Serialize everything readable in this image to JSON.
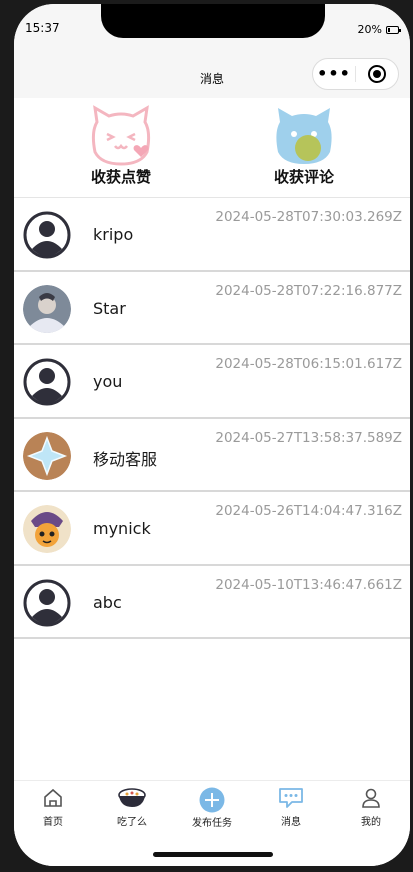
{
  "status_bar": {
    "time": "15:37",
    "battery_percent_text": "20%",
    "battery_level": 0.2
  },
  "nav": {
    "title": "消息"
  },
  "stats": [
    {
      "label": "收获点赞",
      "icon": "cat-heart-icon",
      "color": "#f4b6c0"
    },
    {
      "label": "收获评论",
      "icon": "cat-comment-icon",
      "color": "#9fd0ec"
    }
  ],
  "messages": [
    {
      "name": "kripo",
      "time": "2024-05-28T07:30:03.269Z",
      "avatar": "default-avatar"
    },
    {
      "name": "Star",
      "time": "2024-05-28T07:22:16.877Z",
      "avatar": "photo-avatar"
    },
    {
      "name": "you",
      "time": "2024-05-28T06:15:01.617Z",
      "avatar": "default-avatar"
    },
    {
      "name": "移动客服",
      "time": "2024-05-27T13:58:37.589Z",
      "avatar": "star-avatar"
    },
    {
      "name": "mynick",
      "time": "2024-05-26T14:04:47.316Z",
      "avatar": "cartoon-avatar"
    },
    {
      "name": "abc",
      "time": "2024-05-10T13:46:47.661Z",
      "avatar": "default-avatar"
    }
  ],
  "tabbar": [
    {
      "label": "首页",
      "icon": "home-icon"
    },
    {
      "label": "吃了么",
      "icon": "food-bowl-icon"
    },
    {
      "label": "发布任务",
      "icon": "plus-circle-icon"
    },
    {
      "label": "消息",
      "icon": "chat-bubble-icon",
      "active": true
    },
    {
      "label": "我的",
      "icon": "person-icon"
    }
  ],
  "colors": {
    "accent": "#7bb8e6",
    "text_muted": "#9a9a9a"
  }
}
